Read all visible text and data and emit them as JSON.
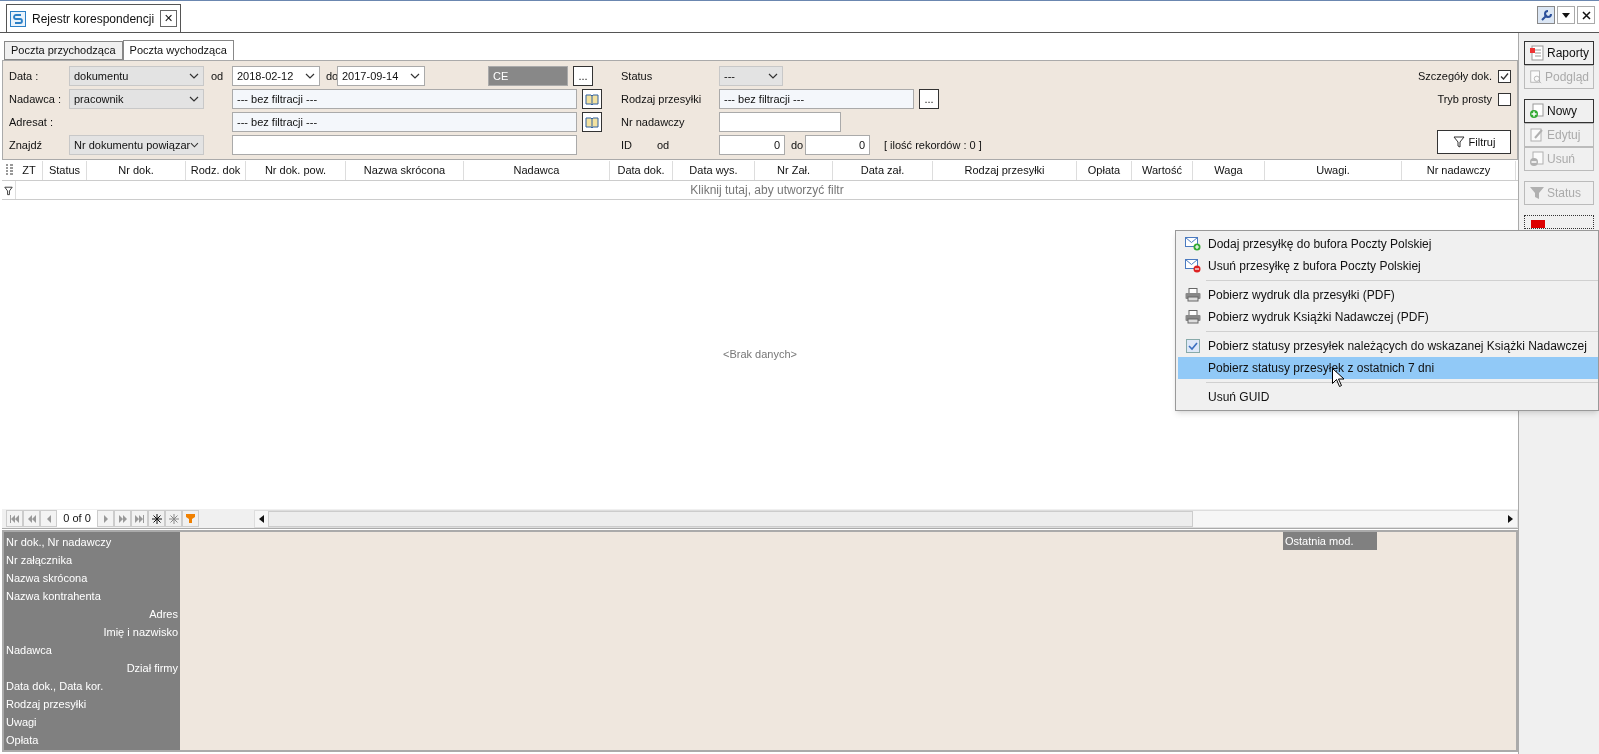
{
  "document_tab": {
    "title": "Rejestr korespondencji",
    "close": "✕"
  },
  "tabs": [
    {
      "label": "Poczta przychodząca",
      "selected": false
    },
    {
      "label": "Poczta wychodząca",
      "selected": true
    }
  ],
  "filters": {
    "date": {
      "label": "Data :",
      "mode": "dokumentu",
      "from_label": "od",
      "from": "2018-02-12",
      "to_label": "do",
      "to": "2017-09-14",
      "code": "CE",
      "more": "..."
    },
    "sender": {
      "label": "Nadawca :",
      "mode": "pracownik",
      "value": "--- bez filtracji ---"
    },
    "recipient": {
      "label": "Adresat :",
      "value": "--- bez filtracji ---"
    },
    "find": {
      "label": "Znajdź",
      "mode": "Nr dokumentu powiązar"
    },
    "status": {
      "label": "Status",
      "value": "---"
    },
    "shipment_type": {
      "label": "Rodzaj przesyłki",
      "value": "--- bez filtracji ---",
      "more": "..."
    },
    "sender_number": {
      "label": "Nr nadawczy"
    },
    "id": {
      "label": "ID",
      "from_label": "od",
      "from": "0",
      "to_label": "do",
      "to": "0"
    },
    "record_count": "[ ilość rekordów : 0 ]",
    "options": [
      {
        "label": "Szczegóły dok.",
        "checked": true
      },
      {
        "label": "Tryb prosty",
        "checked": false
      }
    ],
    "filter_button": "Filtruj"
  },
  "table": {
    "columns": [
      "ZT",
      "Status",
      "Nr dok.",
      "Rodz. dok",
      "Nr dok. pow.",
      "Nazwa skrócona",
      "Nadawca",
      "Data dok.",
      "Data wys.",
      "Nr Zał.",
      "Data zał.",
      "Rodzaj przesyłki",
      "Opłata",
      "Wartość",
      "Waga",
      "Uwagi.",
      "Nr nadawczy"
    ],
    "filter_hint": "Kliknij tutaj, aby utworzyć filtr",
    "empty": "<Brak danych>"
  },
  "navigator": {
    "position": "0 of 0"
  },
  "details": {
    "fields": [
      {
        "label": "Nr dok., Nr nadawczy",
        "kind": "main"
      },
      {
        "label": "Nr załącznika",
        "kind": "main"
      },
      {
        "label": "Nazwa skrócona",
        "kind": "main"
      },
      {
        "label": "Nazwa kontrahenta",
        "kind": "main"
      },
      {
        "label": "Adres",
        "kind": "sub"
      },
      {
        "label": "Imię i nazwisko",
        "kind": "sub"
      },
      {
        "label": "Nadawca",
        "kind": "main"
      },
      {
        "label": "Dział firmy",
        "kind": "sub"
      },
      {
        "label": "Data dok., Data kor.",
        "kind": "main"
      },
      {
        "label": "Rodzaj przesyłki",
        "kind": "main"
      },
      {
        "label": "Uwagi",
        "kind": "main"
      },
      {
        "label": "Opłata",
        "kind": "main"
      }
    ],
    "last_modified": "Ostatnia mod."
  },
  "side_buttons": [
    {
      "label": "Raporty",
      "kind": "report",
      "disabled": false
    },
    {
      "label": "Podgląd",
      "kind": "preview",
      "disabled": true
    },
    {
      "label": "Nowy",
      "kind": "new",
      "disabled": false
    },
    {
      "label": "Edytuj",
      "kind": "edit",
      "disabled": true
    },
    {
      "label": "Usuń",
      "kind": "delete",
      "disabled": true
    },
    {
      "label": "Status",
      "kind": "status",
      "disabled": true
    }
  ],
  "context_menu": [
    {
      "label": "Dodaj przesyłkę do bufora Poczty Polskiej",
      "kind": "mail-add",
      "separator_before": false,
      "selected": false
    },
    {
      "label": "Usuń przesyłkę z bufora Poczty Polskiej",
      "kind": "mail-remove",
      "separator_before": false,
      "selected": false
    },
    {
      "label": "Pobierz wydruk dla przesyłki (PDF)",
      "kind": "printer",
      "separator_before": true,
      "selected": false
    },
    {
      "label": "Pobierz wydruk Książki Nadawczej (PDF)",
      "kind": "printer",
      "separator_before": false,
      "selected": false
    },
    {
      "label": "Pobierz statusy przesyłek należących do wskazanej Książki Nadawczej",
      "kind": "check",
      "separator_before": true,
      "selected": false
    },
    {
      "label": "Pobierz statusy przesyłek z ostatnich 7 dni",
      "kind": "none",
      "separator_before": false,
      "selected": true
    },
    {
      "label": "Usuń GUID",
      "kind": "none",
      "separator_before": true,
      "selected": false
    }
  ]
}
